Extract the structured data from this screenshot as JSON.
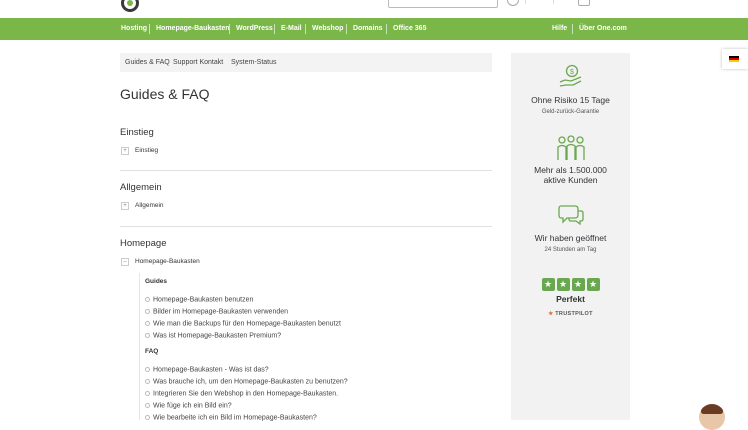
{
  "nav": {
    "items": [
      "Hosting",
      "Homepage-Baukasten",
      "WordPress",
      "E-Mail",
      "Webshop",
      "Domains",
      "Office 365"
    ],
    "right_items": [
      "Hilfe",
      "Über One.com"
    ]
  },
  "breadcrumb": [
    "Guides & FAQ",
    "Support Kontakt",
    "System-Status"
  ],
  "page_title": "Guides & FAQ",
  "sections": [
    {
      "title": "Einstieg",
      "category": "Einstieg",
      "toggle": "+"
    },
    {
      "title": "Allgemein",
      "category": "Allgemein",
      "toggle": "+"
    },
    {
      "title": "Homepage",
      "category": "Homepage-Baukasten",
      "toggle": "–"
    }
  ],
  "guides": {
    "heading": "Guides",
    "items": [
      "Homepage-Baukasten benutzen",
      "Bilder im Homepage-Baukasten verwenden",
      "Wie man die Backups für den Homepage-Baukasten benutzt",
      "Was ist Homepage-Baukasten Premium?"
    ]
  },
  "faq": {
    "heading": "FAQ",
    "items": [
      "Homepage-Baukasten - Was ist das?",
      "Was brauche ich, um den Homepage-Baukasten zu benutzen?",
      "Integrieren Sie den Webshop in den Homepage-Baukasten.",
      "Wie füge ich ein Bild ein?",
      "Wie bearbeite ich ein Bild im Homepage-Baukasten?"
    ]
  },
  "sidebar": {
    "features": [
      {
        "icon": "money-hand-icon",
        "title": "Ohne Risiko 15 Tage",
        "subtitle": "Geld-zurück-Garantie"
      },
      {
        "icon": "people-icon",
        "title_line1": "Mehr als 1.500.000",
        "title_line2": "aktive Kunden"
      },
      {
        "icon": "chat-bubbles-icon",
        "title": "Wir haben geöffnet",
        "subtitle": "24 Stunden am Tag"
      }
    ],
    "rating": {
      "stars": 4,
      "label": "Perfekt",
      "brand": "TRUSTPILOT"
    }
  },
  "colors": {
    "brand_green": "#7ab648",
    "star_green": "#6aa84f"
  }
}
